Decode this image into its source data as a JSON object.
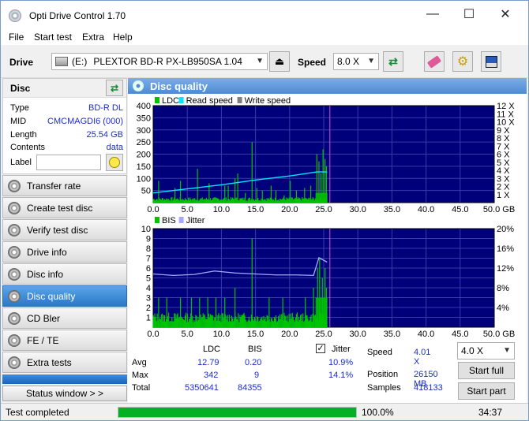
{
  "window": {
    "title": "Opti Drive Control 1.70"
  },
  "menu": [
    "File",
    "Start test",
    "Extra",
    "Help"
  ],
  "toolbar": {
    "drive_label": "Drive",
    "drive_letter": "(E:)",
    "drive_value": "PLEXTOR BD-R  PX-LB950SA 1.04",
    "speed_label": "Speed",
    "speed_value": "8.0 X"
  },
  "disc": {
    "header": "Disc",
    "type_k": "Type",
    "type_v": "BD-R DL",
    "mid_k": "MID",
    "mid_v": "CMCMAGDI6 (000)",
    "length_k": "Length",
    "length_v": "25.54 GB",
    "contents_k": "Contents",
    "contents_v": "data",
    "label_k": "Label",
    "label_v": ""
  },
  "nav": [
    "Transfer rate",
    "Create test disc",
    "Verify test disc",
    "Drive info",
    "Disc info",
    "Disc quality",
    "CD Bler",
    "FE / TE",
    "Extra tests"
  ],
  "nav_active": 5,
  "status_window": "Status window > >",
  "panel_title": "Disc quality",
  "stats": {
    "col_ldc": "LDC",
    "col_bis": "BIS",
    "jitter_label": "Jitter",
    "avg_label": "Avg",
    "avg_ldc": "12.79",
    "avg_bis": "0.20",
    "avg_jitter": "10.9%",
    "max_label": "Max",
    "max_ldc": "342",
    "max_bis": "9",
    "max_jitter": "14.1%",
    "total_label": "Total",
    "total_ldc": "5350641",
    "total_bis": "84355",
    "speed_label": "Speed",
    "speed_value": "4.01 X",
    "position_label": "Position",
    "position_value": "26150 MB",
    "samples_label": "Samples",
    "samples_value": "418133",
    "speed_select": "4.0 X",
    "start_full": "Start full",
    "start_part": "Start part"
  },
  "status": {
    "text": "Test completed",
    "progress_text": "100.0%",
    "progress": 1.0,
    "time": "34:37"
  },
  "colors": {
    "plot_bg": "#00007a",
    "grid": "#3a3aa8",
    "ldc": "#00c400",
    "read": "#00e8ff",
    "jitter": "#a8a8ff",
    "marker": "#d050d0"
  },
  "chart_data": [
    {
      "type": "bar",
      "legend": [
        "LDC",
        "Read speed",
        "Write speed"
      ],
      "x_ticks": [
        "0.0",
        "5.0",
        "10.0",
        "15.0",
        "20.0",
        "25.0",
        "30.0",
        "35.0",
        "40.0",
        "45.0",
        "50.0 GB"
      ],
      "y_ticks": [
        "400",
        "350",
        "300",
        "250",
        "200",
        "150",
        "100",
        "50"
      ],
      "y2_ticks": [
        "12 X",
        "11 X",
        "10 X",
        "9 X",
        "8 X",
        "7 X",
        "6 X",
        "5 X",
        "4 X",
        "3 X",
        "2 X",
        "1 X"
      ],
      "xlim": [
        0,
        50
      ],
      "ylim": [
        0,
        400
      ],
      "y2lim": [
        0,
        12
      ],
      "data_end": 25.54,
      "ldc_base": 15,
      "ldc_spikes": [
        [
          0.8,
          90
        ],
        [
          3.2,
          60
        ],
        [
          4.0,
          90
        ],
        [
          6.5,
          140
        ],
        [
          8.2,
          80
        ],
        [
          10.5,
          70
        ],
        [
          11.0,
          70
        ],
        [
          12.0,
          100
        ],
        [
          12.4,
          120
        ],
        [
          13.5,
          40
        ],
        [
          14.5,
          250
        ],
        [
          15.2,
          60
        ],
        [
          16.0,
          50
        ],
        [
          17.3,
          70
        ],
        [
          18.0,
          50
        ],
        [
          19.2,
          30
        ],
        [
          20.1,
          90
        ],
        [
          21.0,
          50
        ],
        [
          22.2,
          60
        ],
        [
          23.1,
          70
        ],
        [
          24.0,
          200
        ],
        [
          24.3,
          170
        ],
        [
          24.6,
          120
        ],
        [
          24.9,
          220
        ],
        [
          25.2,
          180
        ],
        [
          25.4,
          150
        ]
      ],
      "read_speed": [
        [
          0.0,
          1.2
        ],
        [
          5.0,
          1.7
        ],
        [
          10.0,
          2.2
        ],
        [
          15.0,
          2.8
        ],
        [
          20.0,
          3.3
        ],
        [
          24.0,
          3.8
        ],
        [
          25.5,
          3.8
        ]
      ],
      "write_speed": []
    },
    {
      "type": "bar",
      "legend": [
        "BIS",
        "Jitter"
      ],
      "x_ticks": [
        "0.0",
        "5.0",
        "10.0",
        "15.0",
        "20.0",
        "25.0",
        "30.0",
        "35.0",
        "40.0",
        "45.0",
        "50.0 GB"
      ],
      "y_ticks": [
        "10",
        "9",
        "8",
        "7",
        "6",
        "5",
        "4",
        "3",
        "2",
        "1"
      ],
      "y2_ticks": [
        "20%",
        "16%",
        "12%",
        "8%",
        "4%"
      ],
      "xlim": [
        0,
        50
      ],
      "ylim": [
        0,
        10
      ],
      "y2lim": [
        0,
        20
      ],
      "data_end": 25.54,
      "bis_base": 1,
      "bis_spikes": [
        [
          0.8,
          3
        ],
        [
          2.0,
          3
        ],
        [
          4.0,
          3
        ],
        [
          5.6,
          3
        ],
        [
          6.8,
          3
        ],
        [
          8.0,
          3
        ],
        [
          9.2,
          3
        ],
        [
          10.5,
          3
        ],
        [
          12.0,
          4
        ],
        [
          14.5,
          9
        ],
        [
          17.0,
          3
        ],
        [
          19.0,
          3
        ],
        [
          22.3,
          3
        ],
        [
          23.5,
          4
        ],
        [
          24.1,
          6
        ],
        [
          24.4,
          7
        ],
        [
          24.8,
          5
        ],
        [
          25.2,
          6
        ],
        [
          25.4,
          4
        ]
      ],
      "jitter": [
        [
          0.0,
          10.8
        ],
        [
          3.0,
          10.5
        ],
        [
          6.0,
          10.7
        ],
        [
          9.0,
          11.4
        ],
        [
          12.0,
          11.0
        ],
        [
          15.0,
          10.8
        ],
        [
          18.0,
          10.6
        ],
        [
          21.0,
          10.6
        ],
        [
          23.5,
          10.5
        ],
        [
          24.3,
          14.1
        ],
        [
          25.5,
          13.2
        ]
      ]
    }
  ]
}
